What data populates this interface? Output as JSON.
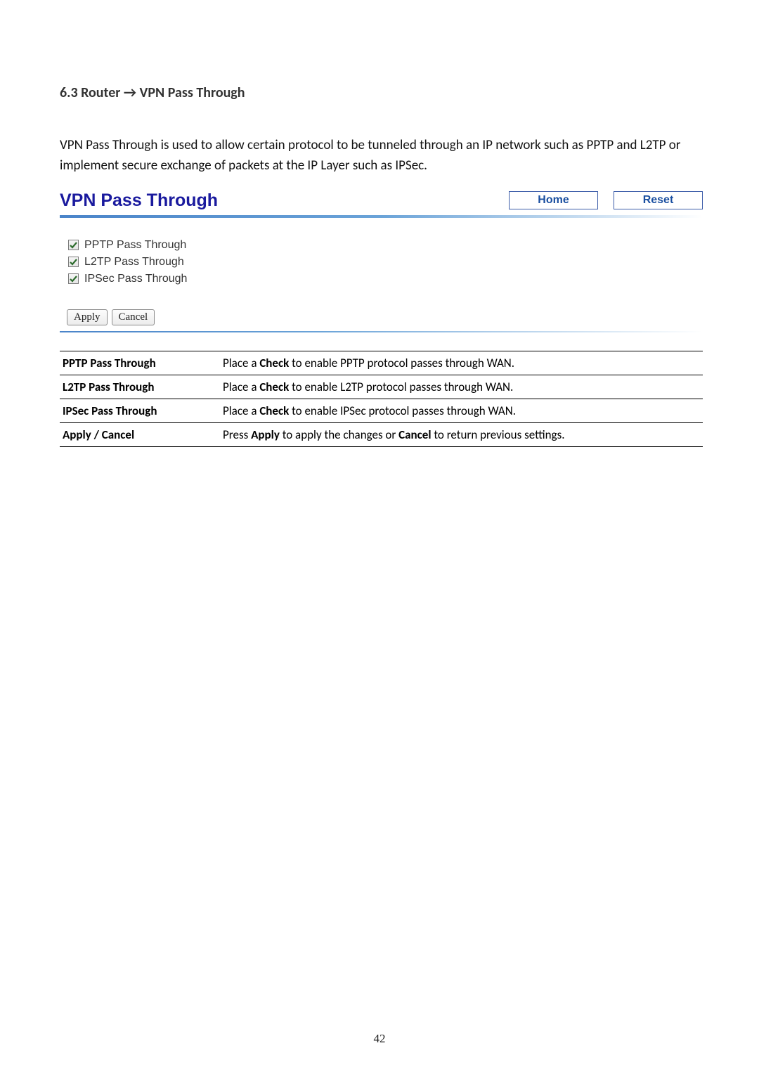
{
  "heading": "6.3 Router → VPN Pass Through",
  "intro": "VPN Pass Through is used to allow certain protocol to be tunneled through an IP network such as PPTP and L2TP or implement secure exchange of packets at the IP Layer such as IPSec.",
  "ui": {
    "title": "VPN Pass Through",
    "home_btn": "Home",
    "reset_btn": "Reset",
    "options": {
      "pptp": "PPTP Pass Through",
      "l2tp": "L2TP Pass Through",
      "ipsec": "IPSec Pass Through"
    },
    "apply_btn": "Apply",
    "cancel_btn": "Cancel"
  },
  "defs": {
    "pptp_label": "PPTP Pass Through",
    "pptp_pre": "Place a ",
    "pptp_bold": "Check",
    "pptp_post": " to enable PPTP protocol passes through WAN.",
    "l2tp_label": "L2TP Pass Through",
    "l2tp_pre": "Place a ",
    "l2tp_bold": "Check",
    "l2tp_post": " to enable L2TP protocol passes through WAN.",
    "ipsec_label": "IPSec Pass Through",
    "ipsec_pre": "Place a ",
    "ipsec_bold": "Check",
    "ipsec_post": " to enable IPSec protocol passes through WAN.",
    "apply_label": "Apply / Cancel",
    "apply_pre": "Press ",
    "apply_bold1": "Apply",
    "apply_mid": " to apply the changes or ",
    "apply_bold2": "Cancel",
    "apply_post": " to return previous settings."
  },
  "page_number": "42"
}
